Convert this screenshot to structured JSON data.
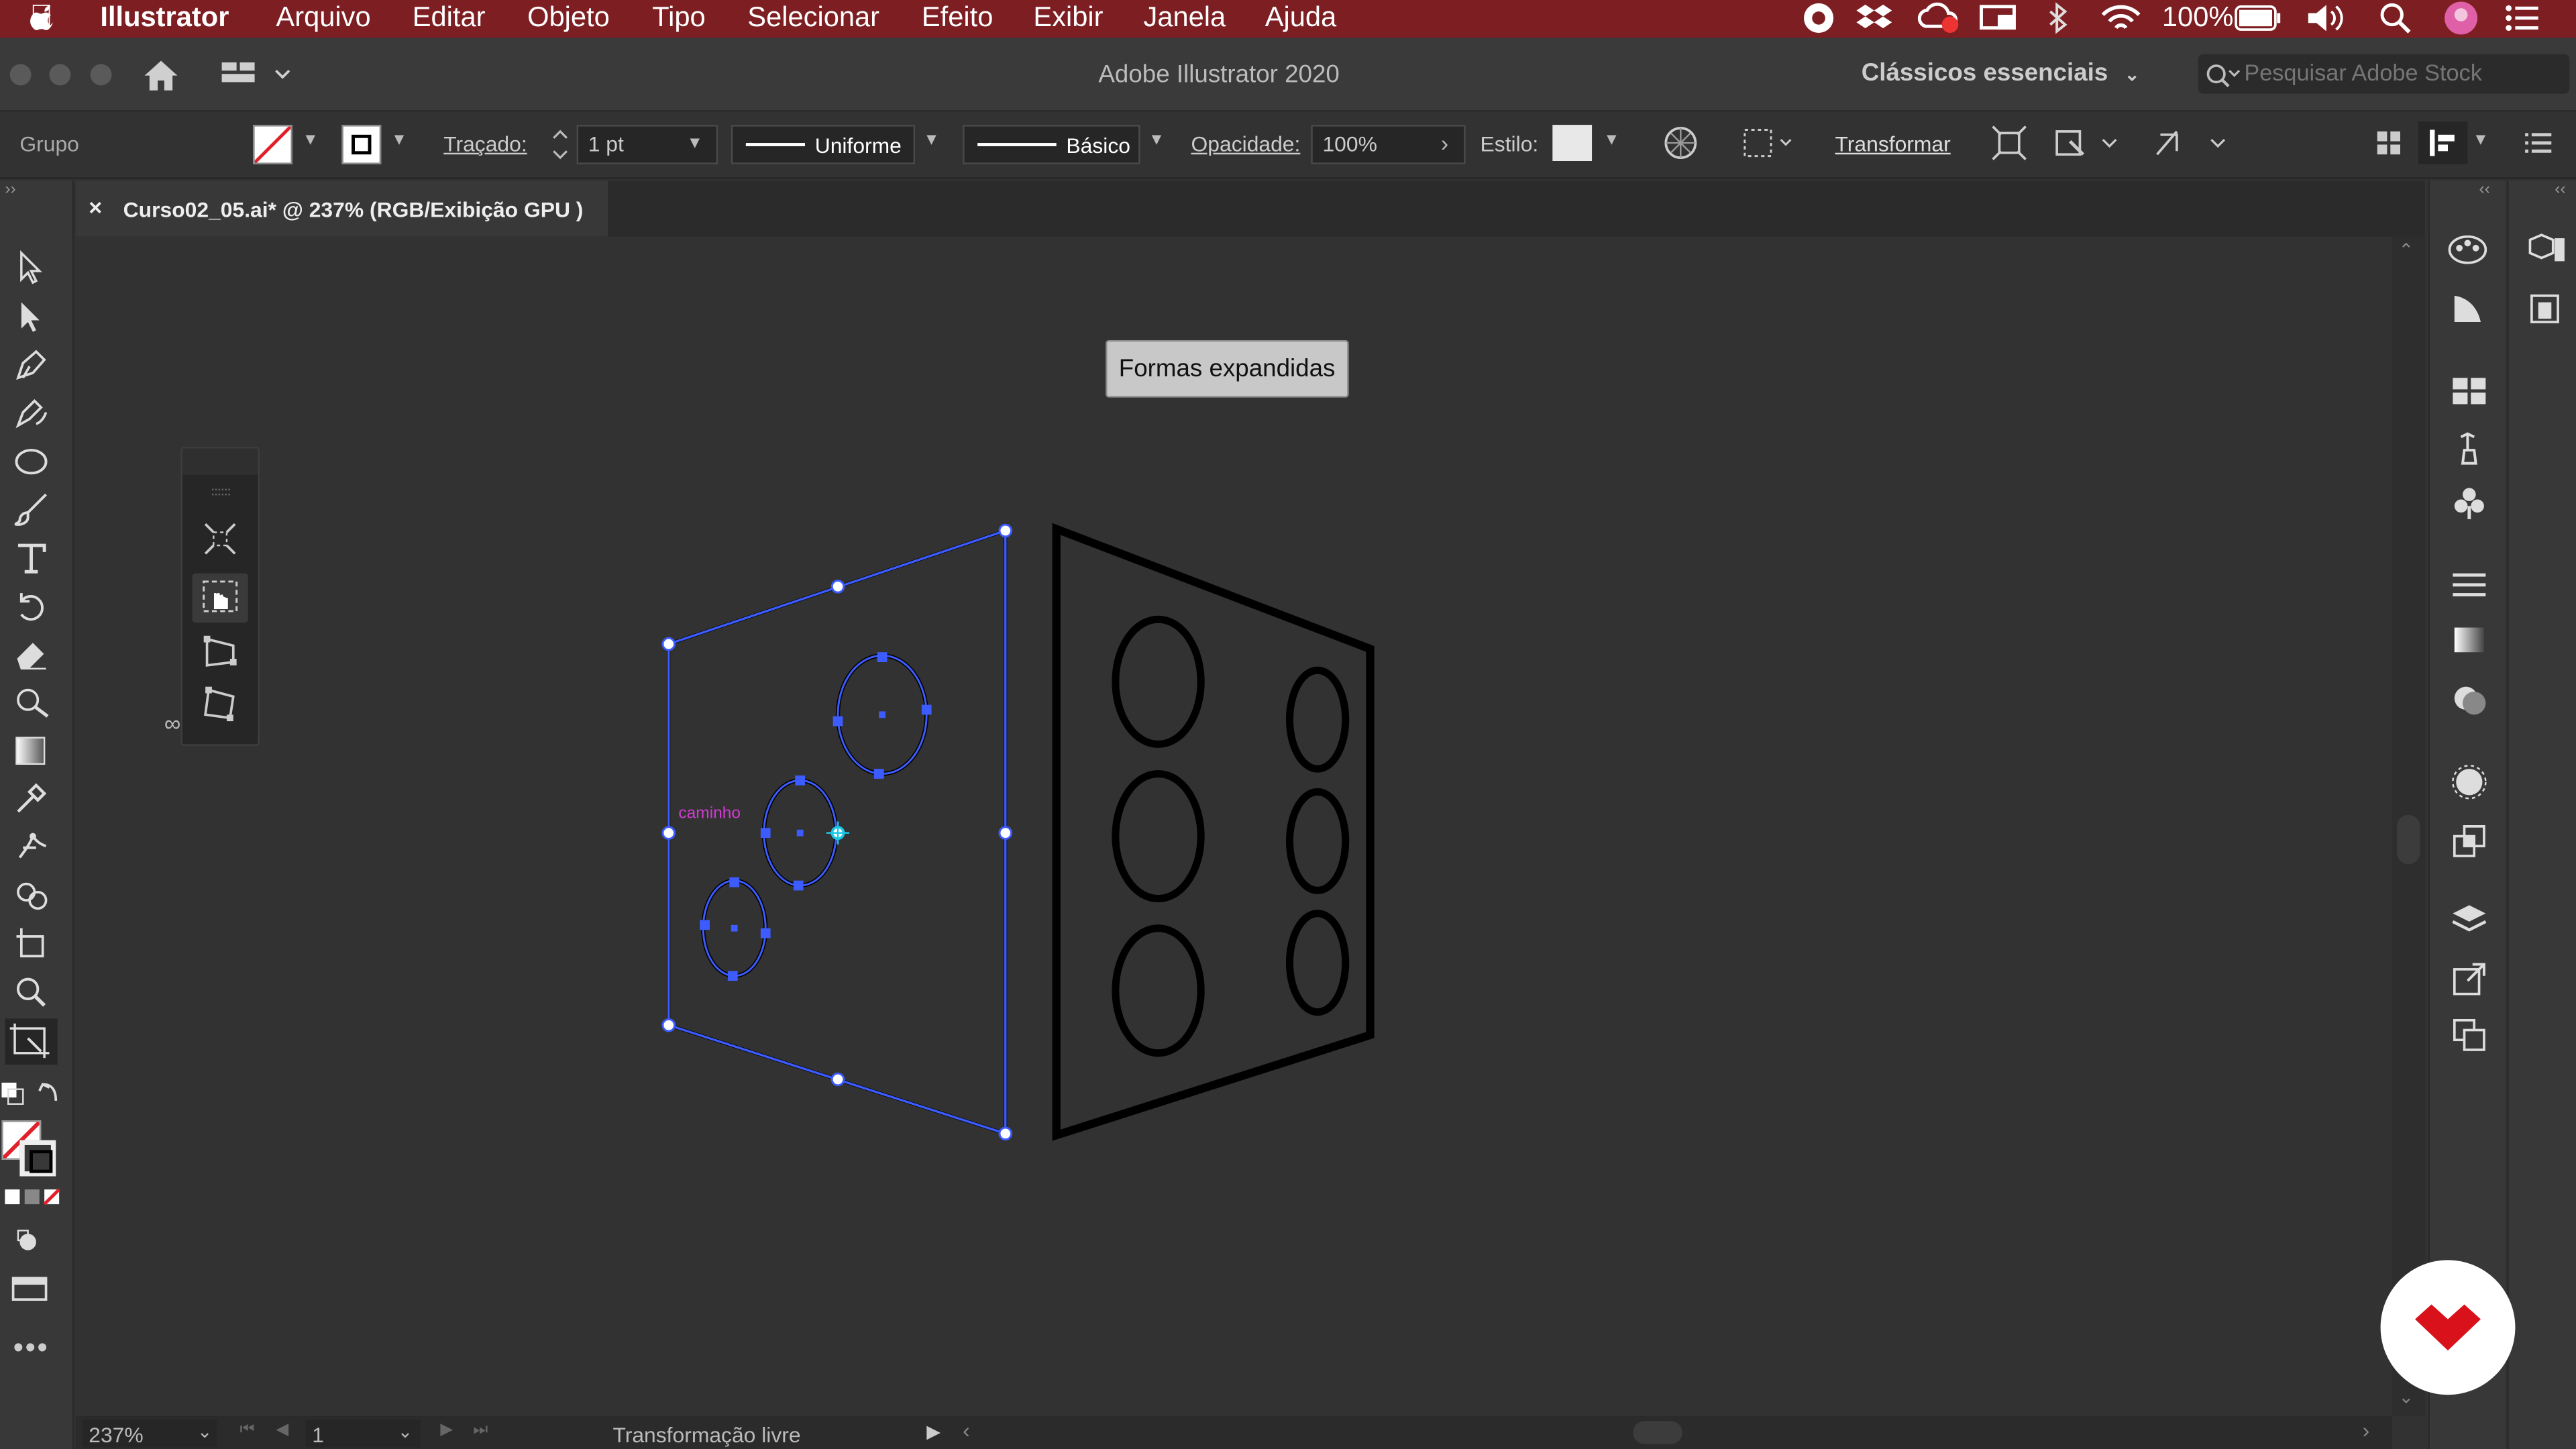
{
  "menubar": {
    "apple": "",
    "items": [
      "Illustrator",
      "Arquivo",
      "Editar",
      "Objeto",
      "Tipo",
      "Selecionar",
      "Efeito",
      "Exibir",
      "Janela",
      "Ajuda"
    ],
    "battery": "100%"
  },
  "titlebar": {
    "title": "Adobe Illustrator 2020",
    "workspace": "Clássicos essenciais",
    "stock_placeholder": "Pesquisar Adobe Stock"
  },
  "control": {
    "selection_type": "Grupo",
    "stroke_label": "Traçado:",
    "stroke_weight": "1 pt",
    "profile_label": "Uniforme",
    "brush_label": "Básico",
    "opacity_label": "Opacidade:",
    "opacity_value": "100%",
    "style_label": "Estilo:",
    "transform_label": "Transformar"
  },
  "document": {
    "tab_close": "×",
    "tab_title": "Curso02_05.ai* @ 237% (RGB/Exibição GPU )"
  },
  "canvas": {
    "tooltip": "Formas expandidas",
    "path_label": "caminho"
  },
  "status": {
    "zoom": "237%",
    "artboard": "1",
    "tool_status": "Transformação livre"
  },
  "colors": {
    "menubar": "#7d1f22",
    "selection": "#3d5cff",
    "label": "#d23bd2",
    "logo": "#d8111b"
  },
  "icons": {
    "lefttoolbar": [
      "selection-icon",
      "direct-selection-icon",
      "pen-icon",
      "curvature-icon",
      "ellipse-icon",
      "paintbrush-icon",
      "type-icon",
      "rotate-icon",
      "eraser-icon",
      "warp-icon",
      "gradient-icon",
      "eyedropper-icon",
      "puppet-warp-icon",
      "shape-builder-icon",
      "artboard-icon",
      "zoom-icon",
      "free-transform-icon"
    ]
  }
}
